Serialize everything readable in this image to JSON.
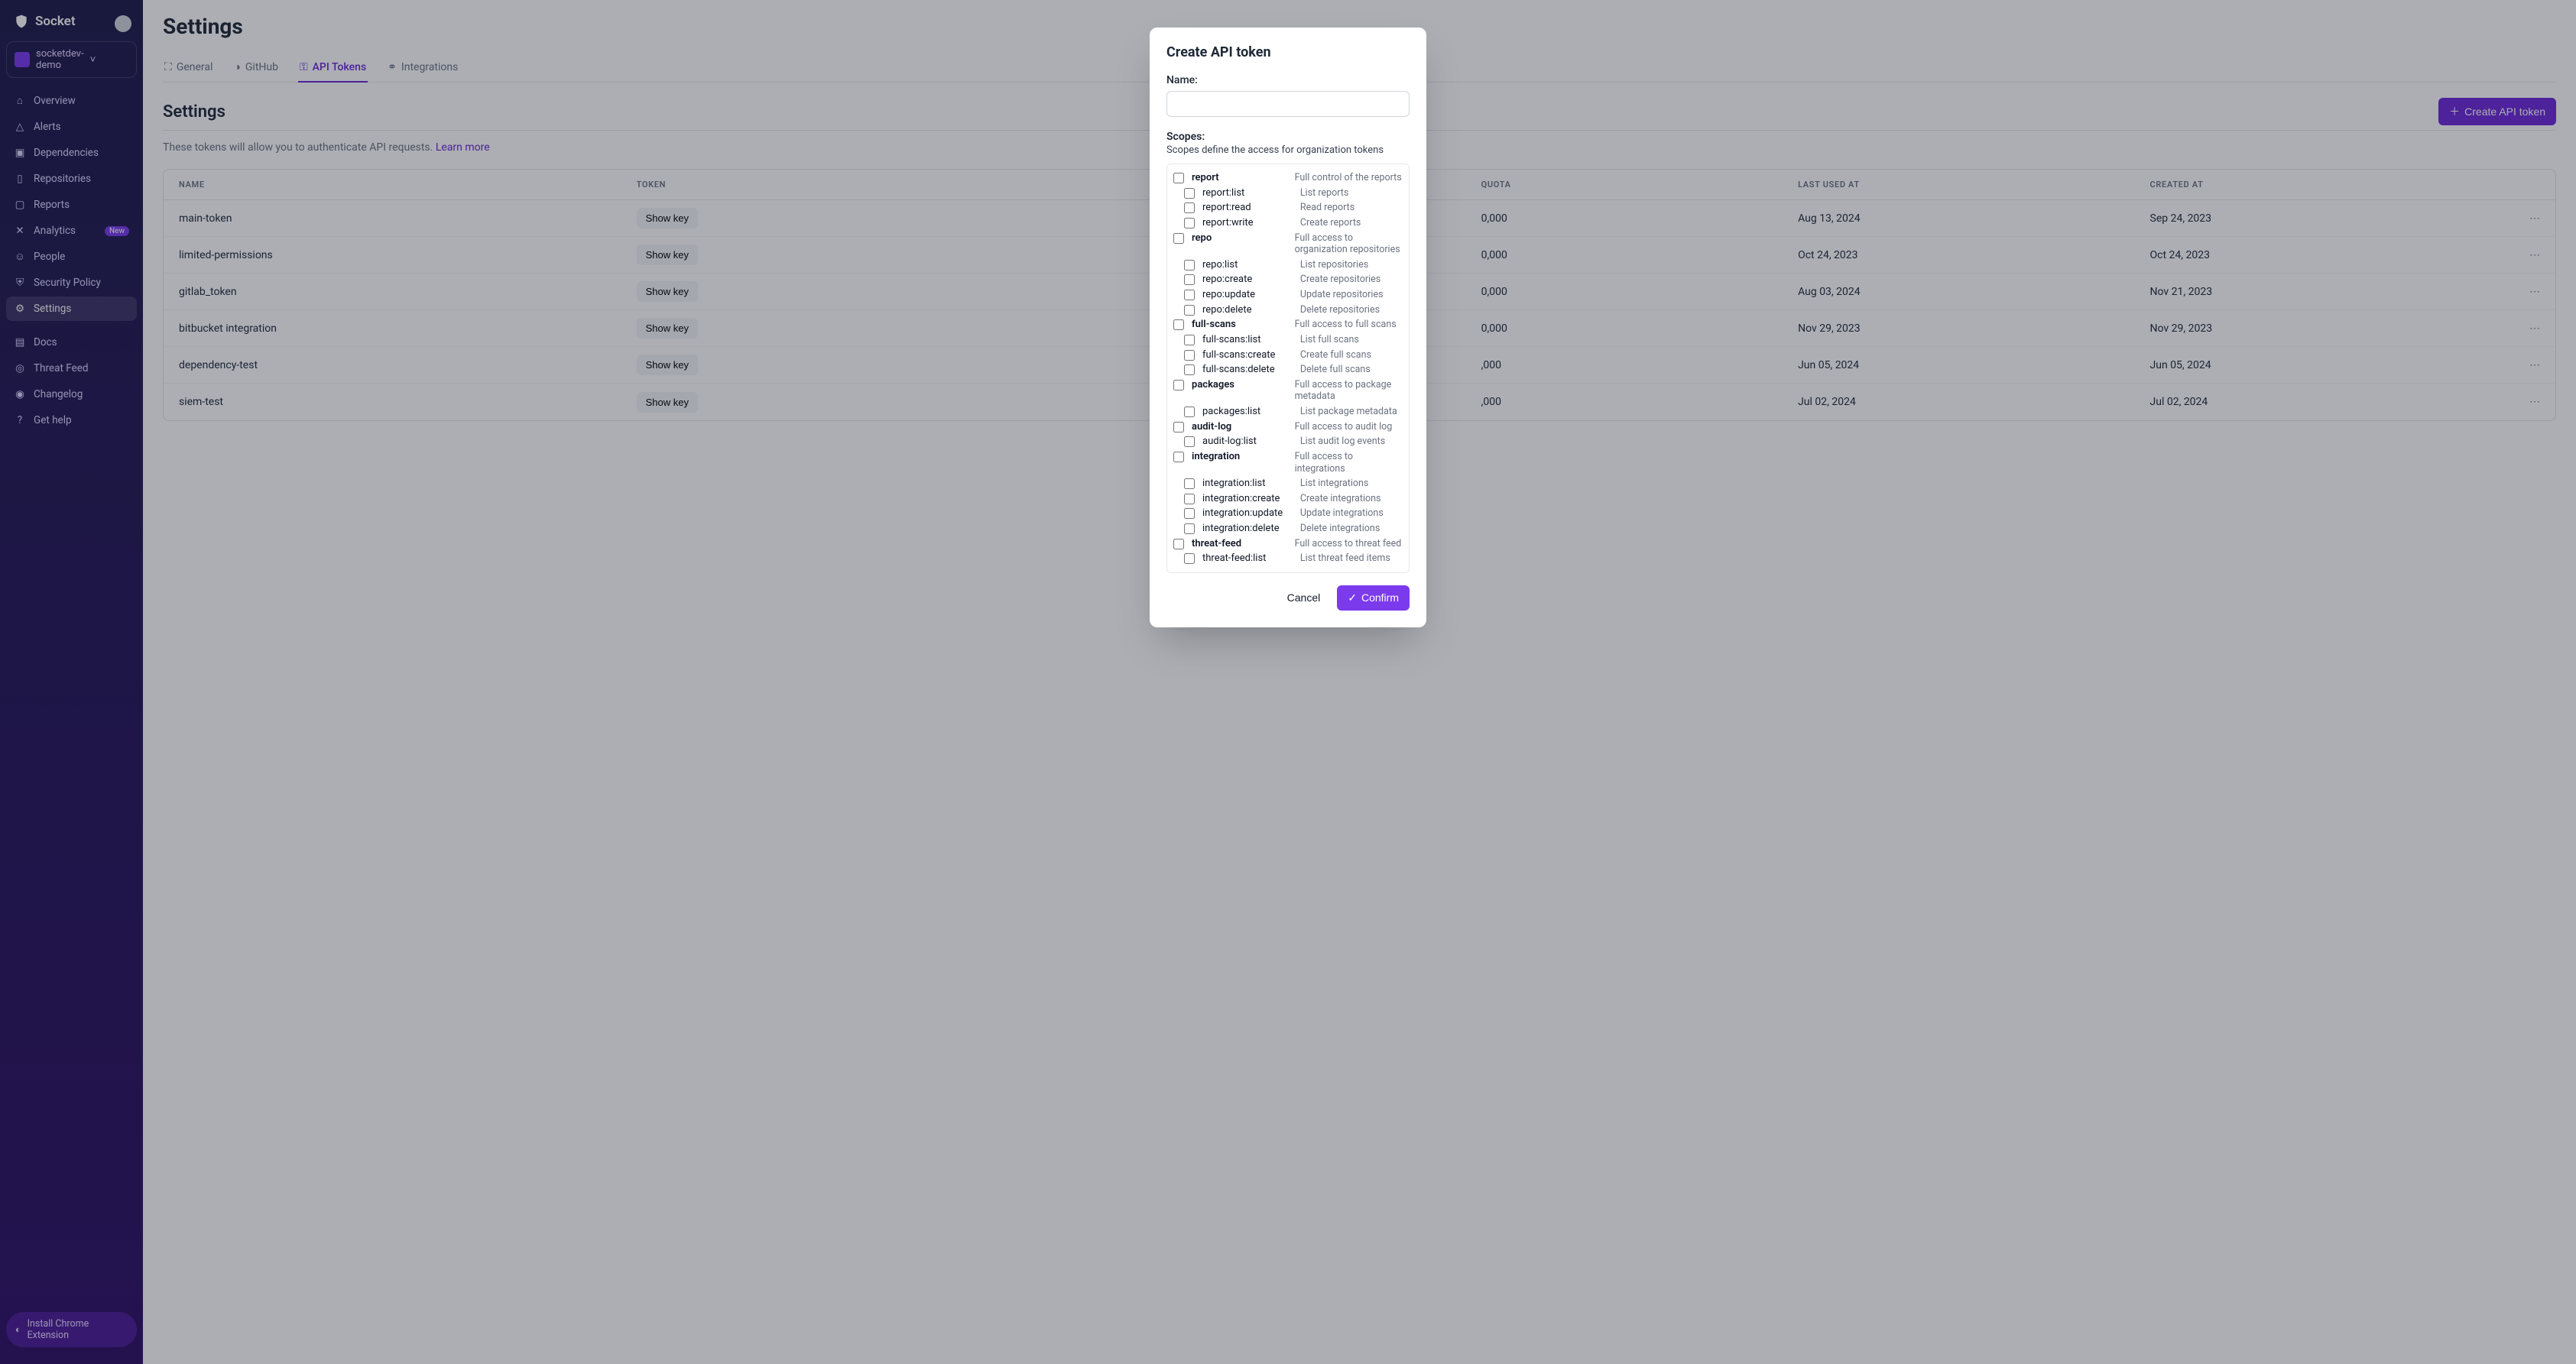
{
  "brand": "Socket",
  "org": {
    "name": "socketdev-demo"
  },
  "sidebar": {
    "items": [
      {
        "label": "Overview"
      },
      {
        "label": "Alerts"
      },
      {
        "label": "Dependencies"
      },
      {
        "label": "Repositories"
      },
      {
        "label": "Reports"
      },
      {
        "label": "Analytics",
        "badge": "New"
      },
      {
        "label": "People"
      },
      {
        "label": "Security Policy"
      },
      {
        "label": "Settings"
      },
      {
        "label": "Docs"
      },
      {
        "label": "Threat Feed"
      },
      {
        "label": "Changelog"
      },
      {
        "label": "Get help"
      }
    ]
  },
  "extension_label": "Install Chrome Extension",
  "page": {
    "title": "Settings",
    "section_title": "Settings"
  },
  "tabs": [
    {
      "label": "General"
    },
    {
      "label": "GitHub"
    },
    {
      "label": "API Tokens"
    },
    {
      "label": "Integrations"
    }
  ],
  "create_button": "Create API token",
  "desc": {
    "text": "These tokens will allow you to authenticate API requests. ",
    "link": "Learn more"
  },
  "table": {
    "show_key": "Show key",
    "headers": {
      "name": "Name",
      "token": "Token",
      "quota": "Quota",
      "last_used": "Last used at",
      "created": "Created at"
    },
    "rows": [
      {
        "name": "main-token",
        "quota": "0,000",
        "last_used": "Aug 13, 2024",
        "created": "Sep 24, 2023"
      },
      {
        "name": "limited-permissions",
        "quota": "0,000",
        "last_used": "Oct 24, 2023",
        "created": "Oct 24, 2023"
      },
      {
        "name": "gitlab_token",
        "quota": "0,000",
        "last_used": "Aug 03, 2024",
        "created": "Nov 21, 2023"
      },
      {
        "name": "bitbucket integration",
        "quota": "0,000",
        "last_used": "Nov 29, 2023",
        "created": "Nov 29, 2023"
      },
      {
        "name": "dependency-test",
        "quota": ",000",
        "last_used": "Jun 05, 2024",
        "created": "Jun 05, 2024"
      },
      {
        "name": "siem-test",
        "quota": ",000",
        "last_used": "Jul 02, 2024",
        "created": "Jul 02, 2024"
      }
    ]
  },
  "modal": {
    "title": "Create API token",
    "name_label": "Name:",
    "scopes_label": "Scopes:",
    "scopes_desc": "Scopes define the access for organization tokens",
    "cancel": "Cancel",
    "confirm": "Confirm",
    "scopes": [
      {
        "name": "report",
        "help": "Full control of the reports",
        "parent": true
      },
      {
        "name": "report:list",
        "help": "List reports"
      },
      {
        "name": "report:read",
        "help": "Read reports"
      },
      {
        "name": "report:write",
        "help": "Create reports"
      },
      {
        "name": "repo",
        "help": "Full access to organization repositories",
        "parent": true
      },
      {
        "name": "repo:list",
        "help": "List repositories"
      },
      {
        "name": "repo:create",
        "help": "Create repositories"
      },
      {
        "name": "repo:update",
        "help": "Update repositories"
      },
      {
        "name": "repo:delete",
        "help": "Delete repositories"
      },
      {
        "name": "full-scans",
        "help": "Full access to full scans",
        "parent": true
      },
      {
        "name": "full-scans:list",
        "help": "List full scans"
      },
      {
        "name": "full-scans:create",
        "help": "Create full scans"
      },
      {
        "name": "full-scans:delete",
        "help": "Delete full scans"
      },
      {
        "name": "packages",
        "help": "Full access to package metadata",
        "parent": true
      },
      {
        "name": "packages:list",
        "help": "List package metadata"
      },
      {
        "name": "audit-log",
        "help": "Full access to audit log",
        "parent": true
      },
      {
        "name": "audit-log:list",
        "help": "List audit log events"
      },
      {
        "name": "integration",
        "help": "Full access to integrations",
        "parent": true
      },
      {
        "name": "integration:list",
        "help": "List integrations"
      },
      {
        "name": "integration:create",
        "help": "Create integrations"
      },
      {
        "name": "integration:update",
        "help": "Update integrations"
      },
      {
        "name": "integration:delete",
        "help": "Delete integrations"
      },
      {
        "name": "threat-feed",
        "help": "Full access to threat feed",
        "parent": true
      },
      {
        "name": "threat-feed:list",
        "help": "List threat feed items"
      }
    ]
  }
}
